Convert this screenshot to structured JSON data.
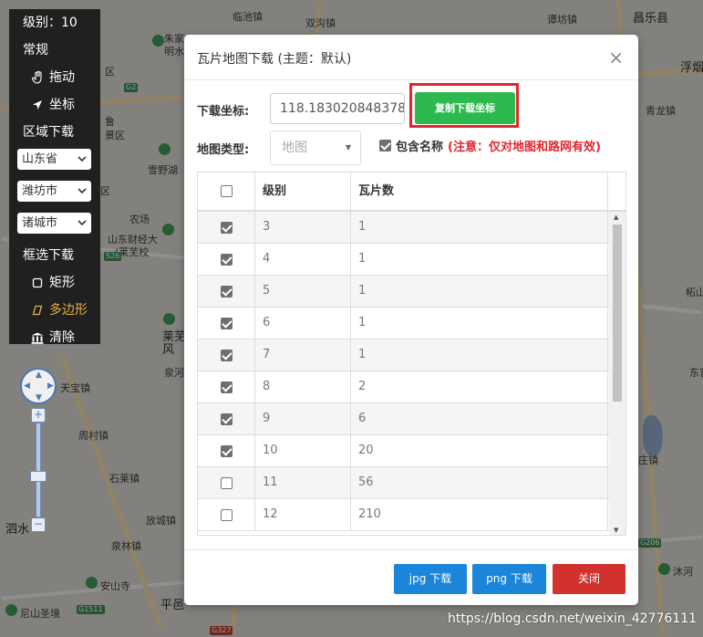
{
  "toolbar": {
    "level": "级别：10",
    "section_general": "常规",
    "drag": "拖动",
    "coordinate": "坐标",
    "section_region": "区域下载",
    "province": "山东省",
    "city": "潍坊市",
    "county": "诸城市",
    "section_box": "框选下载",
    "rectangle": "矩形",
    "polygon": "多边形",
    "clear": "清除"
  },
  "map_labels": [
    "临池镇",
    "双沟镇",
    "谭坊镇",
    "昌乐县",
    "朱家",
    "明水",
    "区",
    "浮烟",
    "鲁",
    "青龙镇",
    "景区",
    "雪野湖",
    "区",
    "农场",
    "山东财经大",
    "(莱芜校",
    "莱芜",
    "风",
    "泉河",
    "天宝镇",
    "周村镇",
    "石莱镇",
    "泗水",
    "放城镇",
    "泉林镇",
    "安山寺",
    "尼山圣境",
    "平邑",
    "柘山",
    "东官",
    "庄镇",
    "沐河",
    "G2",
    "S26",
    "G1511",
    "G327",
    "G206"
  ],
  "modal": {
    "title": "瓦片地图下载 (主题：默认)",
    "close": "×",
    "coord_label": "下载坐标:",
    "coord_value": "118.183020848378",
    "copy_button": "复制下载坐标",
    "maptype_label": "地图类型:",
    "maptype_value": "地图",
    "include_names": "包含名称",
    "include_names_note": "(注意：仅对地图和路网有效)",
    "include_names_checked": true
  },
  "table": {
    "headers": [
      "级别",
      "瓦片数"
    ],
    "rows": [
      {
        "level": "3",
        "tiles": "1",
        "checked": true
      },
      {
        "level": "4",
        "tiles": "1",
        "checked": true
      },
      {
        "level": "5",
        "tiles": "1",
        "checked": true
      },
      {
        "level": "6",
        "tiles": "1",
        "checked": true
      },
      {
        "level": "7",
        "tiles": "1",
        "checked": true
      },
      {
        "level": "8",
        "tiles": "2",
        "checked": true
      },
      {
        "level": "9",
        "tiles": "6",
        "checked": true
      },
      {
        "level": "10",
        "tiles": "20",
        "checked": true
      },
      {
        "level": "11",
        "tiles": "56",
        "checked": false
      },
      {
        "level": "12",
        "tiles": "210",
        "checked": false
      }
    ]
  },
  "footer": {
    "jpg": "jpg 下载",
    "png": "png 下载",
    "close": "关闭"
  },
  "watermark": "https://blog.csdn.net/weixin_42776111",
  "colors": {
    "accent_green": "#2db94d",
    "highlight_red": "#e3262e",
    "primary_blue": "#1a85d9",
    "danger_red": "#d2322d",
    "active_tool": "#e8b048"
  }
}
